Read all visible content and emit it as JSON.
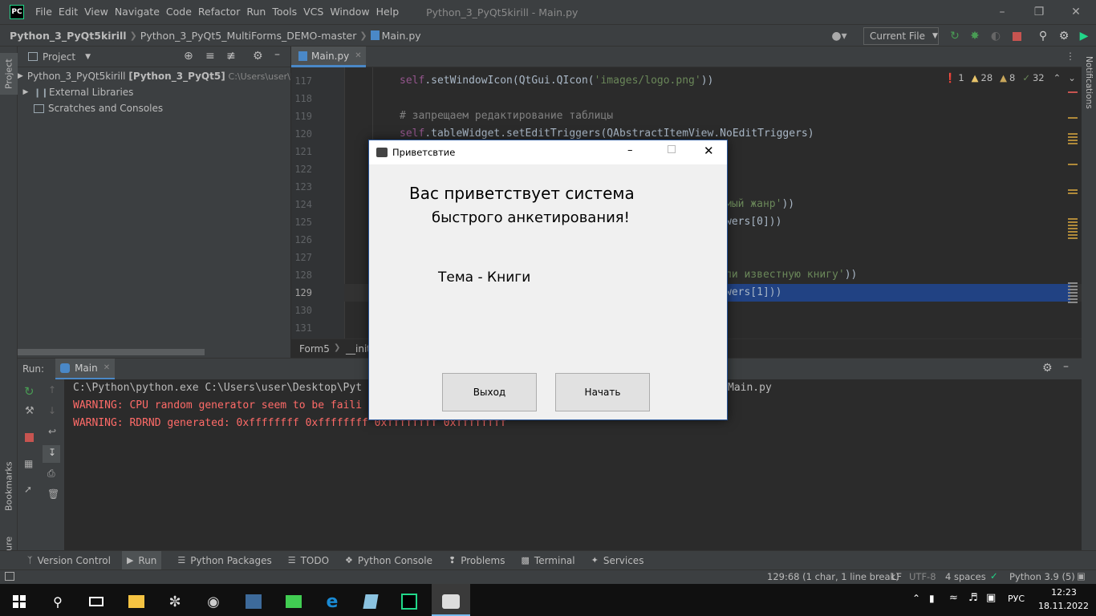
{
  "titlebar": {
    "logo": "PC",
    "menu": [
      "File",
      "Edit",
      "View",
      "Navigate",
      "Code",
      "Refactor",
      "Run",
      "Tools",
      "VCS",
      "Window",
      "Help"
    ],
    "window_title": "Python_3_PyQt5kirill - Main.py"
  },
  "navbar": {
    "project": "Python_3_PyQt5kirill",
    "folder": "Python_3_PyQt5_MultiForms_DEMO-master",
    "file": "Main.py",
    "run_config": "Current File"
  },
  "leftstripe": {
    "project": "Project",
    "bookmarks": "Bookmarks",
    "structure": "Structure"
  },
  "rightstripe": {
    "notifications": "Notifications"
  },
  "project_panel": {
    "title": "Project",
    "items": [
      {
        "name": "Python_3_PyQt5kirill",
        "bold": "[Python_3_PyQt5]",
        "path": "C:\\Users\\user\\D"
      },
      {
        "name": "External Libraries"
      },
      {
        "name": "Scratches and Consoles"
      }
    ]
  },
  "editor": {
    "tab": "Main.py",
    "inspections": {
      "errors": "1",
      "warnings": "28",
      "weak": "8",
      "ok": "32"
    },
    "line_numbers": [
      "117",
      "118",
      "119",
      "120",
      "121",
      "122",
      "123",
      "124",
      "125",
      "126",
      "127",
      "128",
      "129",
      "130",
      "131"
    ],
    "lines": {
      "l117": {
        "self": "self",
        "mid": ".setWindowIcon(QtGui.QIcon(",
        "str": "'images/logo.png'",
        "end": "))"
      },
      "l119": "# запрещаем редактирование таблицы",
      "l120": {
        "self": "self",
        "mid": ".tableWidget.setEditTriggers(QAbstractItemView.NoEditTriggers)"
      },
      "l124": {
        "str": "мый жанр'",
        "end": "))"
      },
      "l125": "wers[0]))",
      "l128": {
        "str": "ли известную книгу'",
        "end": "))"
      },
      "l129": "wers[1]))"
    },
    "breadcrumb": [
      "Form5",
      "__init"
    ]
  },
  "run": {
    "label": "Run:",
    "tab": "Main",
    "console": [
      "C:\\Python\\python.exe C:\\Users\\user\\Desktop\\Pyt",
      "Main.py",
      "WARNING: CPU random generator seem to be faili",
      "WARNING: RDRND generated: 0xffffffff 0xffffffff 0xffffffff 0xffffffff"
    ]
  },
  "bottom_tabs": [
    "Version Control",
    "Run",
    "Python Packages",
    "TODO",
    "Python Console",
    "Problems",
    "Terminal",
    "Services"
  ],
  "statusbar": {
    "position": "129:68 (1 char, 1 line break)",
    "line_sep": "LF",
    "encoding": "UTF-8",
    "indent": "4 spaces",
    "interpreter": "Python 3.9 (5)"
  },
  "taskbar": {
    "lang": "РУС",
    "time": "12:23",
    "date": "18.11.2022"
  },
  "dialog": {
    "title": "Приветсвтие",
    "heading1": "Вас приветствует система",
    "heading2": "быстрого анкетирования!",
    "topic": "Тема - Книги",
    "exit_button": "Выход",
    "start_button": "Начать"
  },
  "colors": {
    "accent": "#2b579a",
    "selection": "#214283",
    "warning": "#ff6b68"
  }
}
